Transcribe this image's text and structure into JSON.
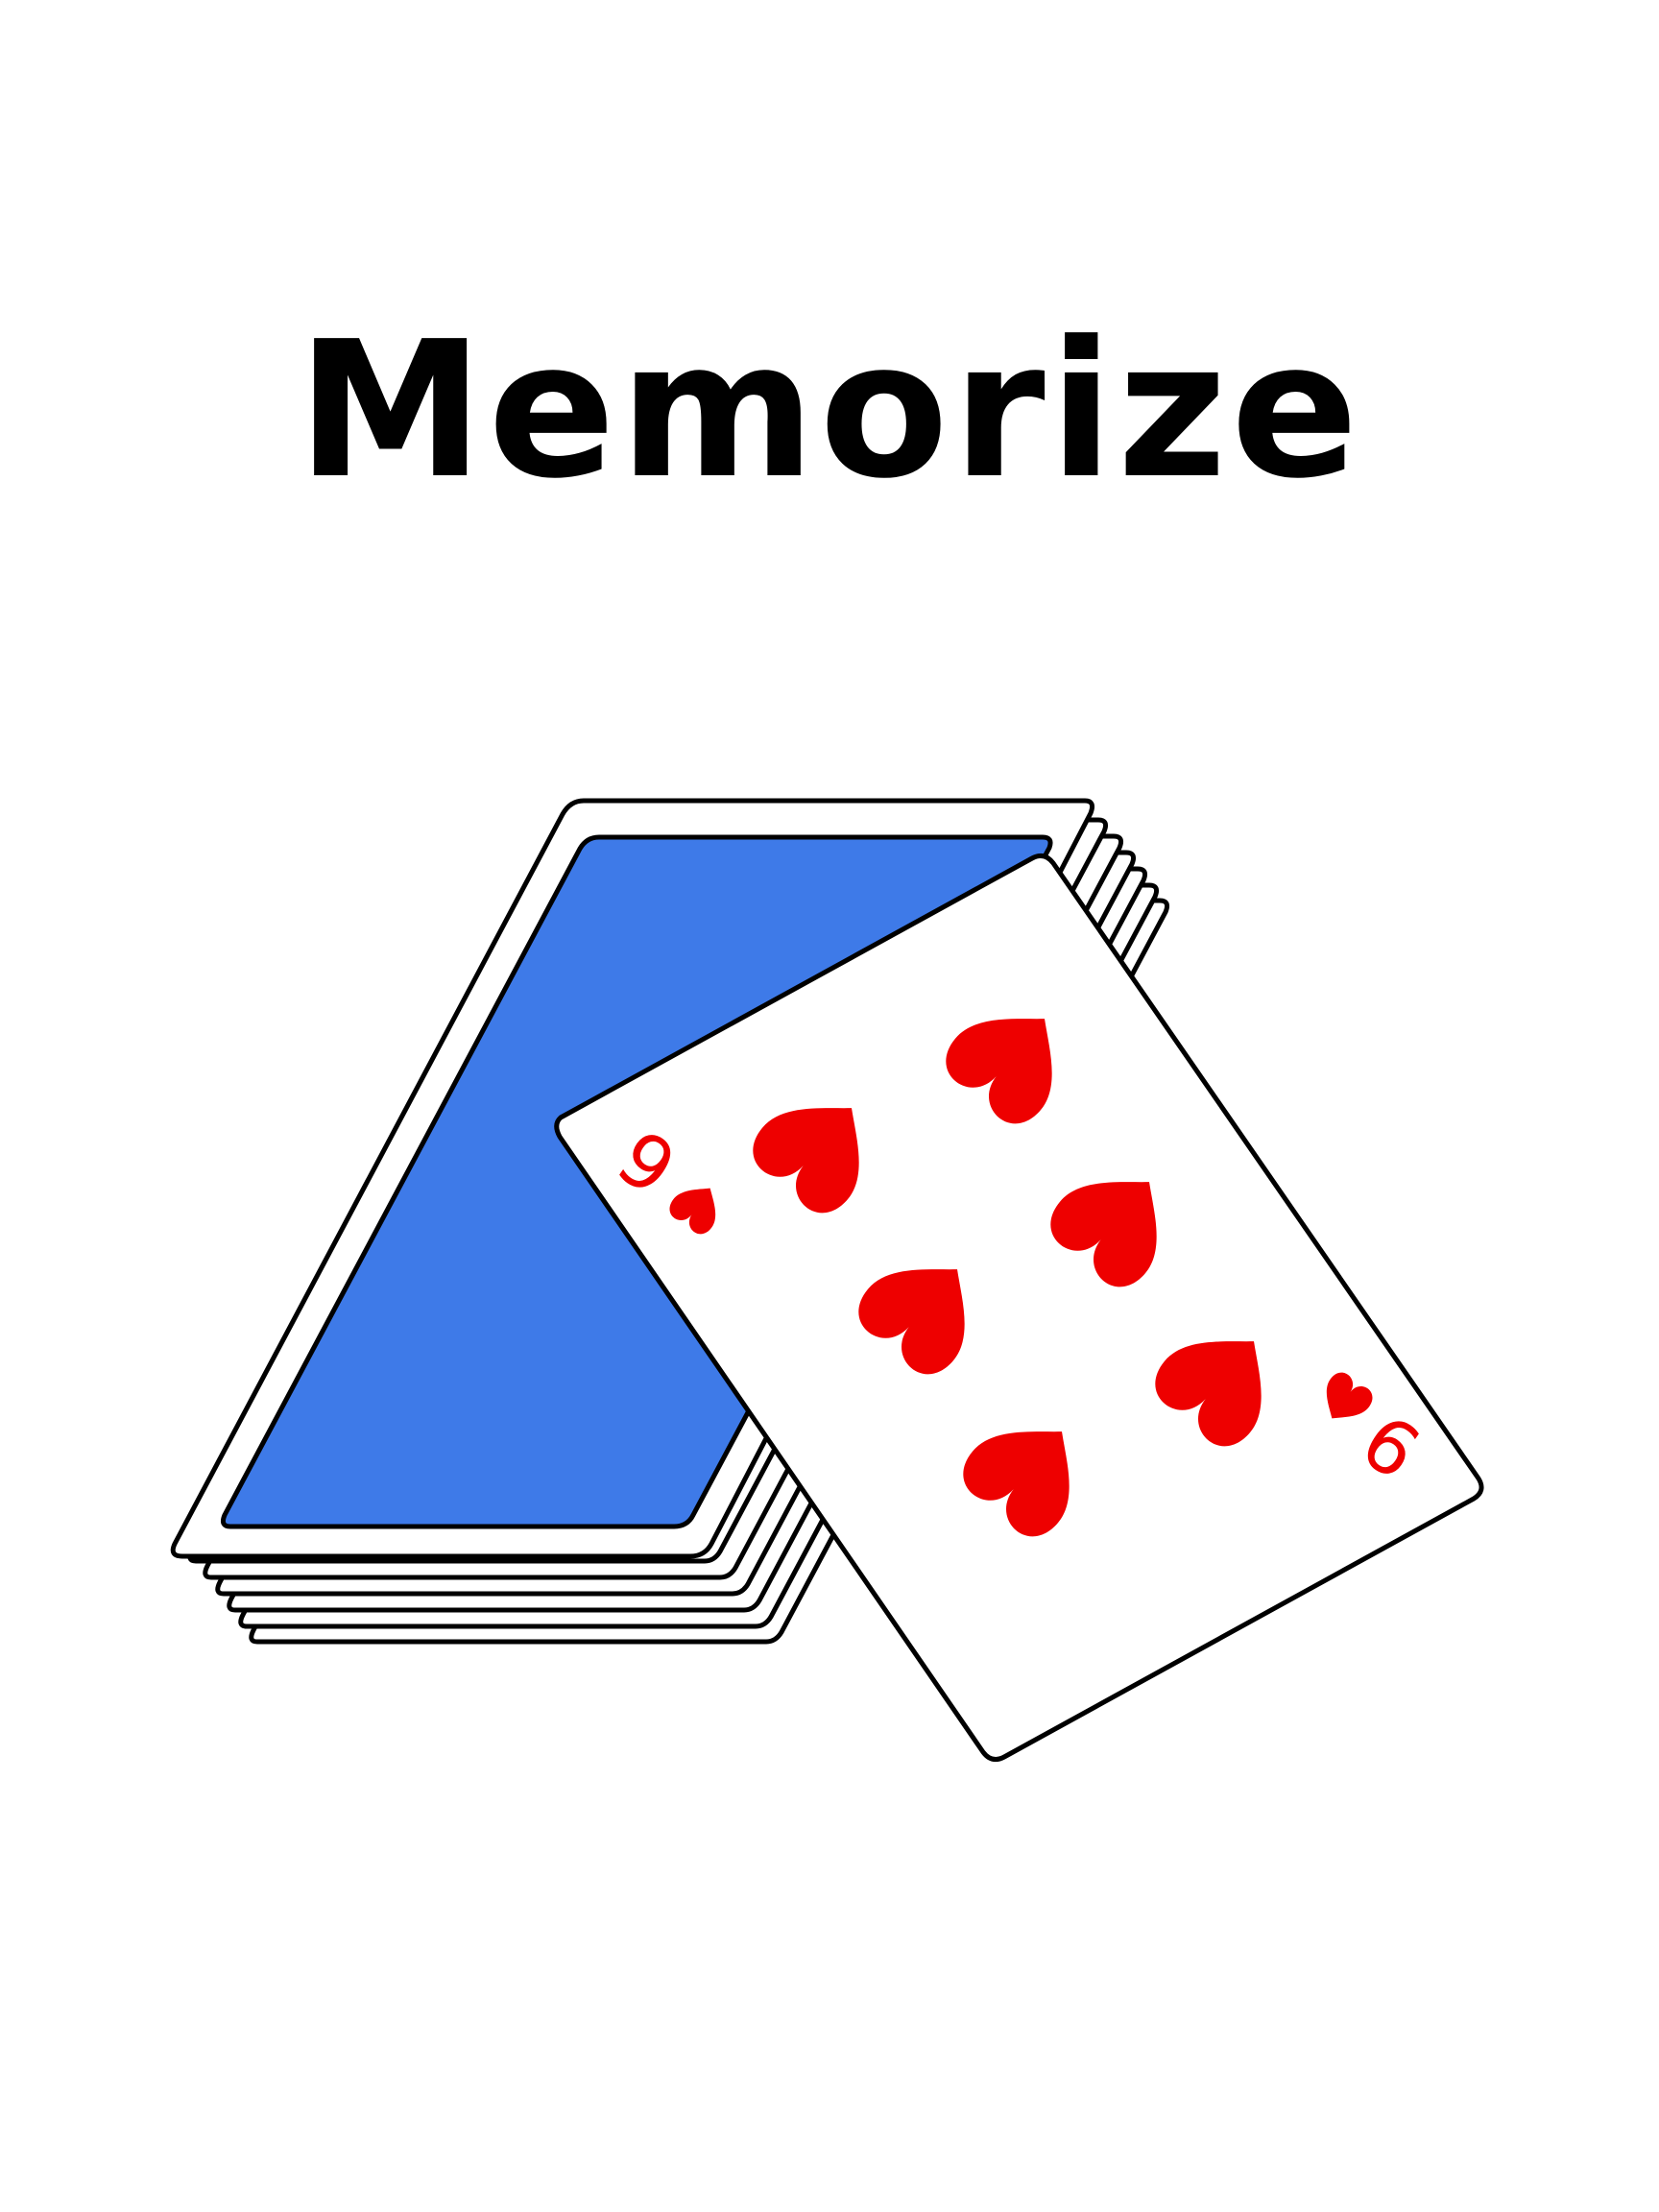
{
  "title": "Memorize",
  "colors": {
    "background": "#ffffff",
    "title": "#000000",
    "card_back": "#3e7ae8",
    "card_face": "#ffffff",
    "outline": "#000000",
    "suit": "#ee0000"
  },
  "card": {
    "rank": "6",
    "suit": "hearts",
    "suit_icon": "heart-icon",
    "pips": 6
  },
  "deck": {
    "stacked_cards": 7
  }
}
